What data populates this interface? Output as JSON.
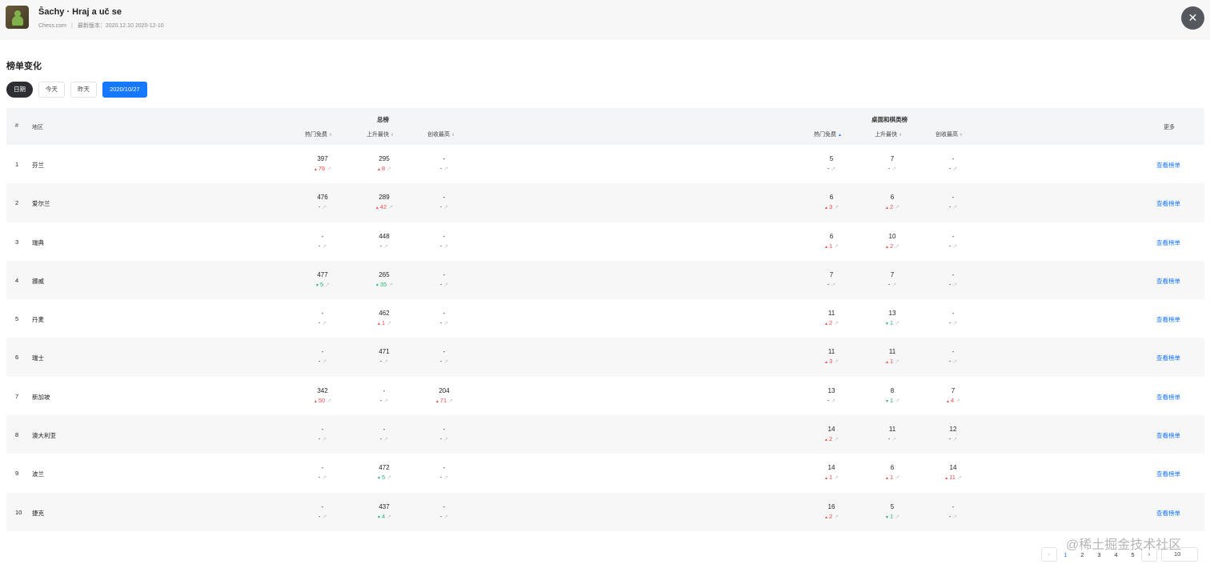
{
  "app": {
    "title": "Šachy · Hraj a uč se",
    "developer": "Chess.com",
    "separator": "|",
    "version_label": "最新版本：2020.12.10 2020-12-10",
    "close_glyph": "✕"
  },
  "section_title": "榜单变化",
  "filters": {
    "label": "日期",
    "today": "今天",
    "yesterday": "昨天",
    "date": "2020/10/27"
  },
  "table": {
    "col_index": "#",
    "col_region": "地区",
    "group_overall": "总榜",
    "group_category": "桌面和棋类榜",
    "col_more": "更多",
    "sub_free": "热门免费",
    "sub_rising": "上升最快",
    "sub_grossing": "创收最高",
    "sort_glyph": "⬍",
    "sort_on_glyph": "▲",
    "link_label": "查看榜单",
    "trend_glyph": "↗",
    "up_glyph": "▲",
    "down_glyph": "▼",
    "rows": [
      {
        "idx": "1",
        "region": "芬兰",
        "cells": [
          {
            "v": "397",
            "d": "76",
            "t": "up"
          },
          {
            "v": "295",
            "d": "8",
            "t": "up"
          },
          {
            "v": "-",
            "d": "-",
            "t": ""
          },
          {
            "v": "5",
            "d": "-",
            "t": ""
          },
          {
            "v": "7",
            "d": "-",
            "t": ""
          },
          {
            "v": "-",
            "d": "-",
            "t": ""
          }
        ]
      },
      {
        "idx": "2",
        "region": "爱尔兰",
        "cells": [
          {
            "v": "476",
            "d": "-",
            "t": ""
          },
          {
            "v": "289",
            "d": "42",
            "t": "up"
          },
          {
            "v": "-",
            "d": "-",
            "t": ""
          },
          {
            "v": "6",
            "d": "3",
            "t": "up"
          },
          {
            "v": "6",
            "d": "2",
            "t": "up"
          },
          {
            "v": "-",
            "d": "-",
            "t": ""
          }
        ]
      },
      {
        "idx": "3",
        "region": "瑞典",
        "cells": [
          {
            "v": "-",
            "d": "-",
            "t": ""
          },
          {
            "v": "448",
            "d": "-",
            "t": ""
          },
          {
            "v": "-",
            "d": "-",
            "t": ""
          },
          {
            "v": "6",
            "d": "1",
            "t": "up"
          },
          {
            "v": "10",
            "d": "2",
            "t": "up"
          },
          {
            "v": "-",
            "d": "-",
            "t": ""
          }
        ]
      },
      {
        "idx": "4",
        "region": "挪威",
        "cells": [
          {
            "v": "477",
            "d": "5",
            "t": "down"
          },
          {
            "v": "265",
            "d": "35",
            "t": "down"
          },
          {
            "v": "-",
            "d": "-",
            "t": ""
          },
          {
            "v": "7",
            "d": "-",
            "t": ""
          },
          {
            "v": "7",
            "d": "-",
            "t": ""
          },
          {
            "v": "-",
            "d": "-",
            "t": ""
          }
        ]
      },
      {
        "idx": "5",
        "region": "丹麦",
        "cells": [
          {
            "v": "-",
            "d": "-",
            "t": ""
          },
          {
            "v": "462",
            "d": "1",
            "t": "up"
          },
          {
            "v": "-",
            "d": "-",
            "t": ""
          },
          {
            "v": "11",
            "d": "2",
            "t": "up"
          },
          {
            "v": "13",
            "d": "1",
            "t": "down"
          },
          {
            "v": "-",
            "d": "-",
            "t": ""
          }
        ]
      },
      {
        "idx": "6",
        "region": "瑞士",
        "cells": [
          {
            "v": "-",
            "d": "-",
            "t": ""
          },
          {
            "v": "471",
            "d": "-",
            "t": ""
          },
          {
            "v": "-",
            "d": "-",
            "t": ""
          },
          {
            "v": "11",
            "d": "3",
            "t": "up"
          },
          {
            "v": "11",
            "d": "1",
            "t": "up"
          },
          {
            "v": "-",
            "d": "-",
            "t": ""
          }
        ]
      },
      {
        "idx": "7",
        "region": "新加坡",
        "cells": [
          {
            "v": "342",
            "d": "50",
            "t": "up"
          },
          {
            "v": "-",
            "d": "-",
            "t": ""
          },
          {
            "v": "204",
            "d": "71",
            "t": "up"
          },
          {
            "v": "13",
            "d": "-",
            "t": ""
          },
          {
            "v": "8",
            "d": "1",
            "t": "down"
          },
          {
            "v": "7",
            "d": "4",
            "t": "up"
          }
        ]
      },
      {
        "idx": "8",
        "region": "澳大利亚",
        "cells": [
          {
            "v": "-",
            "d": "-",
            "t": ""
          },
          {
            "v": "-",
            "d": "-",
            "t": ""
          },
          {
            "v": "-",
            "d": "-",
            "t": ""
          },
          {
            "v": "14",
            "d": "2",
            "t": "up"
          },
          {
            "v": "11",
            "d": "-",
            "t": ""
          },
          {
            "v": "12",
            "d": "-",
            "t": ""
          }
        ]
      },
      {
        "idx": "9",
        "region": "波兰",
        "cells": [
          {
            "v": "-",
            "d": "-",
            "t": ""
          },
          {
            "v": "472",
            "d": "5",
            "t": "down"
          },
          {
            "v": "-",
            "d": "-",
            "t": ""
          },
          {
            "v": "14",
            "d": "1",
            "t": "up"
          },
          {
            "v": "6",
            "d": "1",
            "t": "up"
          },
          {
            "v": "14",
            "d": "11",
            "t": "up"
          }
        ]
      },
      {
        "idx": "10",
        "region": "捷克",
        "cells": [
          {
            "v": "-",
            "d": "-",
            "t": ""
          },
          {
            "v": "437",
            "d": "4",
            "t": "down"
          },
          {
            "v": "-",
            "d": "-",
            "t": ""
          },
          {
            "v": "16",
            "d": "2",
            "t": "up"
          },
          {
            "v": "5",
            "d": "1",
            "t": "down"
          },
          {
            "v": "-",
            "d": "-",
            "t": ""
          }
        ]
      }
    ]
  },
  "pagination": {
    "prev": "‹",
    "next": "›",
    "pages": [
      "1",
      "2",
      "3",
      "4",
      "5"
    ],
    "current": "1",
    "page_size": "10"
  },
  "watermark": "@稀土掘金技术社区",
  "colors": {
    "accent": "#1677ff",
    "up": "#f04b4b",
    "down": "#22b573"
  }
}
